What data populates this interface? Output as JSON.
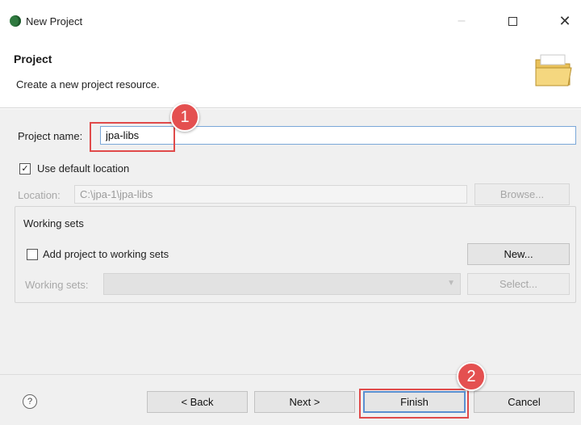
{
  "window": {
    "title": "New Project",
    "minimize_glyph": "–",
    "close_glyph": "✕"
  },
  "header": {
    "title": "Project",
    "description": "Create a new project resource."
  },
  "form": {
    "project_name_label": "Project name:",
    "project_name_value": "jpa-libs",
    "use_default_location_label": "Use default location",
    "use_default_location_checked": true,
    "location_label": "Location:",
    "location_value": "C:\\jpa-1\\jpa-libs",
    "browse_button": "Browse...",
    "working_sets_group_label": "Working sets",
    "add_to_working_sets_label": "Add project to working sets",
    "add_to_working_sets_checked": false,
    "new_button": "New...",
    "working_sets_label": "Working sets:",
    "working_sets_value": "",
    "select_button": "Select..."
  },
  "footer": {
    "help_glyph": "?",
    "back_button": "< Back",
    "next_button": "Next >",
    "finish_button": "Finish",
    "cancel_button": "Cancel"
  },
  "annotations": {
    "step1": "1",
    "step2": "2",
    "color": "#e04a4a"
  },
  "icons": {
    "app": "eclipse-icon",
    "header": "folder-icon",
    "help": "help-icon"
  }
}
